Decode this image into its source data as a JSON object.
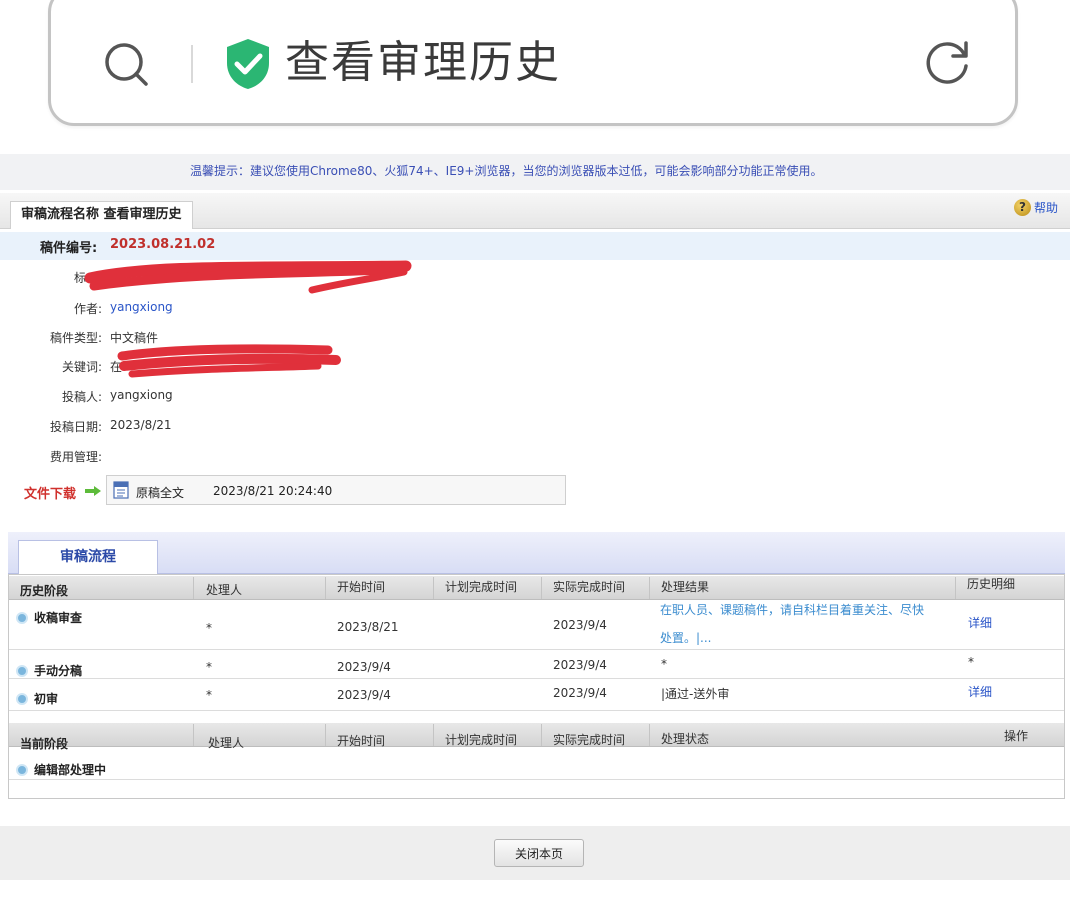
{
  "browser": {
    "page_title": "查看审理历史",
    "search_icon": "search-icon",
    "secure_icon": "shield-check-icon",
    "reload_icon": "reload-icon"
  },
  "notice": "温馨提示：建议您使用Chrome80、火狐74+、IE9+浏览器，当您的浏览器版本过低，可能会影响部分功能正常使用。",
  "header": {
    "title": "审稿流程名称 查看审理历史",
    "help_label": "帮助"
  },
  "manuscript": {
    "number_label": "稿件编号:",
    "number": "2023.08.21.02",
    "fields": {
      "title_label": "标",
      "author_label": "作者:",
      "author": "yangxiong",
      "type_label": "稿件类型:",
      "type": "中文稿件",
      "keywords_label": "关键词:",
      "keywords": "在",
      "submitter_label": "投稿人:",
      "submitter": "yangxiong",
      "date_label": "投稿日期:",
      "date": "2023/8/21",
      "fee_label": "费用管理:"
    }
  },
  "download": {
    "label": "文件下载",
    "file_name": "原稿全文",
    "file_date": "2023/8/21 20:24:40"
  },
  "workflow": {
    "tab_label": "审稿流程",
    "history_headers": [
      "历史阶段",
      "处理人",
      "开始时间",
      "计划完成时间",
      "实际完成时间",
      "处理结果",
      "历史明细"
    ],
    "history_rows": [
      {
        "stage": "收稿审查",
        "handler": "*",
        "start": "2023/8/21",
        "planned": "",
        "actual": "2023/9/4",
        "result_line1": "在职人员、课题稿件，请自科栏目着重关注、尽快",
        "result_line2": "处置。|...",
        "detail": "详细"
      },
      {
        "stage": "手动分稿",
        "handler": "*",
        "start": "2023/9/4",
        "planned": "",
        "actual": "2023/9/4",
        "result": "*",
        "detail": "*"
      },
      {
        "stage": "初审",
        "handler": "*",
        "start": "2023/9/4",
        "planned": "",
        "actual": "2023/9/4",
        "result": "|通过-送外审",
        "detail": "详细"
      }
    ],
    "current_headers": [
      "当前阶段",
      "处理人",
      "开始时间",
      "计划完成时间",
      "实际完成时间",
      "处理状态",
      "操作"
    ],
    "current_rows": [
      {
        "stage": "编辑部处理中"
      }
    ]
  },
  "footer": {
    "close_label": "关闭本页"
  }
}
